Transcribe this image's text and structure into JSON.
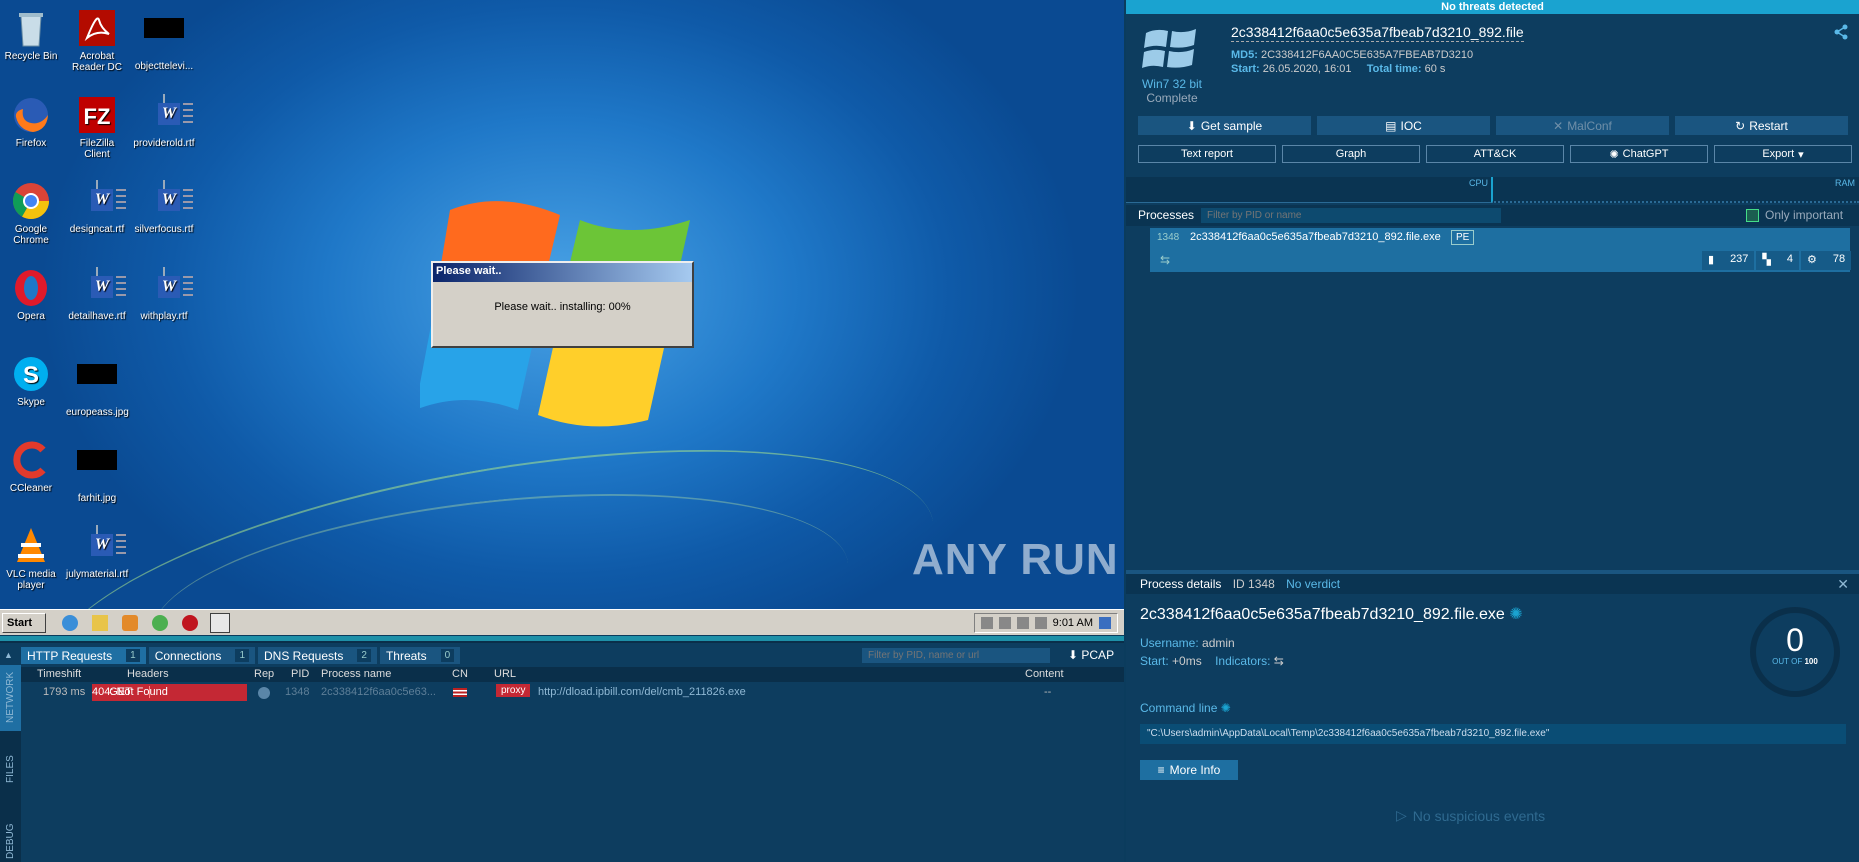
{
  "desktop": {
    "icons": [
      {
        "label": "Recycle Bin"
      },
      {
        "label": "Acrobat Reader DC"
      },
      {
        "label": "objecttelevi..."
      },
      {
        "label": "Firefox"
      },
      {
        "label": "FileZilla Client"
      },
      {
        "label": "providerold.rtf"
      },
      {
        "label": "Google Chrome"
      },
      {
        "label": "designcat.rtf"
      },
      {
        "label": "silverfocus.rtf"
      },
      {
        "label": "Opera"
      },
      {
        "label": "detailhave.rtf"
      },
      {
        "label": "withplay.rtf"
      },
      {
        "label": "Skype"
      },
      {
        "label": "europeass.jpg"
      },
      {
        "label": "CCleaner"
      },
      {
        "label": "farhit.jpg"
      },
      {
        "label": "VLC media player"
      },
      {
        "label": "julymaterial.rtf"
      }
    ],
    "dialog": {
      "title": "Please wait..",
      "message": "Please wait.. installing: 00%"
    },
    "watermark": "ANY RUN"
  },
  "taskbar": {
    "start_label": "Start",
    "clock": "9:01 AM"
  },
  "network": {
    "tabs": [
      {
        "label": "HTTP Requests",
        "count": "1"
      },
      {
        "label": "Connections",
        "count": "1"
      },
      {
        "label": "DNS Requests",
        "count": "2"
      },
      {
        "label": "Threats",
        "count": "0"
      }
    ],
    "filter_placeholder": "Filter by PID, name or url",
    "pcap_label": "PCAP",
    "side_tabs": [
      "NETWORK",
      "FILES",
      "DEBUG"
    ],
    "columns": [
      "Timeshift",
      "Headers",
      "Rep",
      "PID",
      "Process name",
      "CN",
      "URL",
      "Content"
    ],
    "rows": [
      {
        "timeshift": "1793 ms",
        "method": "GET",
        "status": "404: Not Found",
        "pid": "1348",
        "process": "2c338412f6aa0c5e63...",
        "tag": "proxy",
        "url": "http://dload.ipbill.com/del/cmb_211826.exe",
        "content": "--"
      }
    ]
  },
  "report": {
    "verdict": "No threats detected",
    "os": "Win7 32 bit",
    "os_status": "Complete",
    "filename": "2c338412f6aa0c5e635a7fbeab7d3210_892.file",
    "md5_label": "MD5:",
    "md5": "2C338412F6AA0C5E635A7FBEAB7D3210",
    "start_label": "Start:",
    "start": "26.05.2020, 16:01",
    "total_label": "Total time:",
    "total": "60 s",
    "buttons_primary": [
      "Get sample",
      "IOC",
      "MalConf",
      "Restart"
    ],
    "buttons_secondary": [
      "Text report",
      "Graph",
      "ATT&CK",
      "ChatGPT",
      "Export"
    ],
    "graph_cpu": "CPU",
    "graph_ram": "RAM",
    "processes_title": "Processes",
    "processes_filter_placeholder": "Filter by PID or name",
    "only_important": "Only important",
    "process": {
      "pid": "1348",
      "name": "2c338412f6aa0c5e635a7fbeab7d3210_892.file.exe",
      "badge": "PE",
      "files": "237",
      "registry": "4",
      "modules": "78"
    },
    "details": {
      "title": "Process details",
      "id": "ID 1348",
      "verdict": "No verdict",
      "name": "2c338412f6aa0c5e635a7fbeab7d3210_892.file.exe",
      "username_label": "Username:",
      "username": "admin",
      "start_label": "Start:",
      "start": "+0ms",
      "indicators_label": "Indicators:",
      "score": "0",
      "score_suffix_pre": "OUT OF",
      "score_suffix": "100",
      "cmdline_title": "Command line",
      "cmdline": "\"C:\\Users\\admin\\AppData\\Local\\Temp\\2c338412f6aa0c5e635a7fbeab7d3210_892.file.exe\"",
      "more_info": "More Info",
      "no_events": "No suspicious events"
    }
  }
}
